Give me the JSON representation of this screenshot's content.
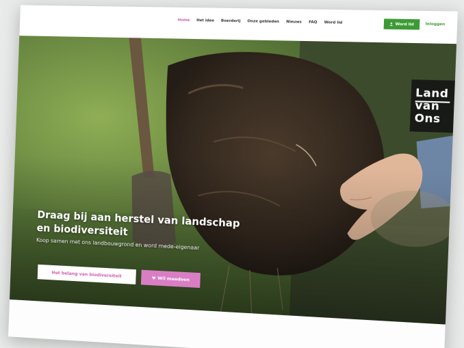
{
  "nav": {
    "items": [
      {
        "label": "Home",
        "active": true
      },
      {
        "label": "Het idee",
        "active": false
      },
      {
        "label": "Boerderij",
        "active": false
      },
      {
        "label": "Onze gebieden",
        "active": false
      },
      {
        "label": "Nieuws",
        "active": false
      },
      {
        "label": "FAQ",
        "active": false
      },
      {
        "label": "Word lid",
        "active": false
      }
    ]
  },
  "header": {
    "cta_label": "Word lid",
    "cta_icon": "user-icon",
    "login_label": "Inloggen"
  },
  "logo": {
    "line1": "Land",
    "line2": "van",
    "line3": "Ons"
  },
  "hero": {
    "headline": "Draag bij aan herstel van landschap en biodiversiteit",
    "subline": "Koop samen met ons landbouwgrond en word mede-eigenaar",
    "primary_button": "Het belang van biodiversiteit",
    "secondary_button": "Wil meedoen",
    "secondary_icon": "heart-icon"
  },
  "colors": {
    "accent_pink": "#d15cae",
    "button_pink": "#d97ec4",
    "green": "#3d9b35",
    "logo_bg": "#181a17"
  }
}
